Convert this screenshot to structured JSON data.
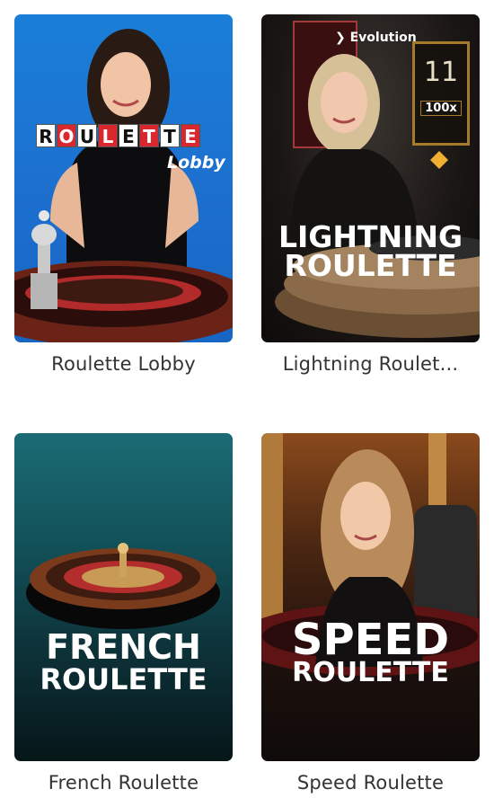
{
  "tiles": [
    {
      "caption": "Roulette Lobby",
      "logo_letters": [
        "R",
        "O",
        "U",
        "L",
        "E",
        "T",
        "T",
        "E"
      ],
      "logo_sub": "Lobby"
    },
    {
      "caption": "Lightning Roulet...",
      "provider": "Evolution",
      "logo_line1": "LIGHTNING",
      "logo_line2": "ROULETTE",
      "panel_number": "11",
      "panel_multiplier": "100x"
    },
    {
      "caption": "French Roulette",
      "logo_line1": "FRENCH",
      "logo_line2": "ROULETTE"
    },
    {
      "caption": "Speed Roulette",
      "logo_line1": "SPEED",
      "logo_line2": "ROULETTE"
    }
  ],
  "colors": {
    "lobby_bg": "#1d6fce",
    "roulette_red": "#d8272d",
    "caption_text": "#333333"
  }
}
